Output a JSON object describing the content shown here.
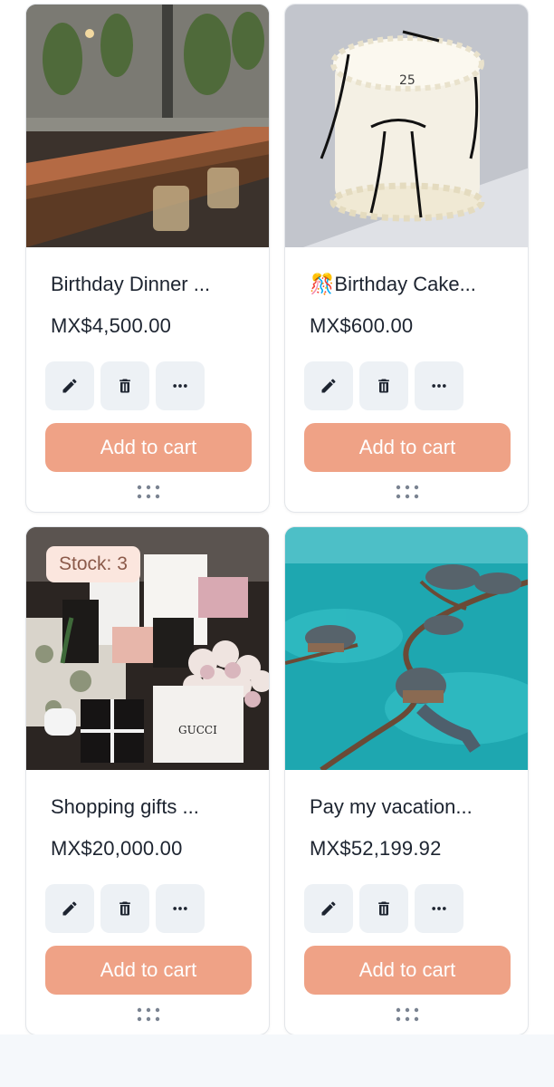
{
  "products": [
    {
      "title": "Birthday Dinner ...",
      "price": "MX$4,500.00",
      "image": "restaurant-dining-photo",
      "add_to_cart_label": "Add to cart"
    },
    {
      "title": "🎊Birthday Cake...",
      "price": "MX$600.00",
      "image": "white-birthday-cake-photo",
      "add_to_cart_label": "Add to cart"
    },
    {
      "title": "Shopping gifts ...",
      "price": "MX$20,000.00",
      "image": "luxury-shopping-bags-photo",
      "stock_badge": "Stock: 3",
      "add_to_cart_label": "Add to cart"
    },
    {
      "title": "Pay my vacation...",
      "price": "MX$52,199.92",
      "image": "overwater-bungalows-photo",
      "add_to_cart_label": "Add to cart"
    }
  ],
  "icons": {
    "edit": "pencil-icon",
    "delete": "trash-icon",
    "more": "more-horizontal-icon",
    "drag": "drag-handle-icon"
  },
  "colors": {
    "accent": "#efa286",
    "icon_button_bg": "#edf1f5",
    "badge_bg": "#fbe6de",
    "text": "#1d2430"
  }
}
